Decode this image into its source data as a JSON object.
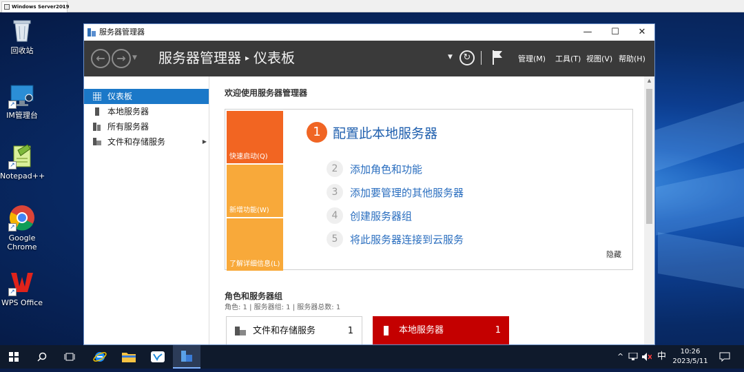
{
  "vm": {
    "tab_title": "Windows Server2019",
    "tab_close": "✕"
  },
  "desktop": {
    "icons": [
      {
        "label": "回收站"
      },
      {
        "label": "IM管理台"
      },
      {
        "label": "Notepad++"
      },
      {
        "label": "Google\nChrome"
      },
      {
        "label": "WPS Office"
      }
    ]
  },
  "window": {
    "title": "服务器管理器",
    "controls": {
      "minimize": "—",
      "maximize": "☐",
      "close": "✕"
    },
    "breadcrumb": {
      "root": "服务器管理器",
      "separator": "▸",
      "current": "仪表板"
    },
    "menu": {
      "manage": "管理(M)",
      "tools": "工具(T)",
      "view": "视图(V)",
      "help": "帮助(H)"
    },
    "sidebar": {
      "items": [
        {
          "label": "仪表板",
          "icon": "dashboard-icon"
        },
        {
          "label": "本地服务器",
          "icon": "server-icon"
        },
        {
          "label": "所有服务器",
          "icon": "servers-icon"
        },
        {
          "label": "文件和存储服务",
          "icon": "storage-icon"
        }
      ]
    },
    "welcome": {
      "title": "欢迎使用服务器管理器",
      "tiles": [
        {
          "label": "快速启动(Q)",
          "color": "#f26522"
        },
        {
          "label": "新增功能(W)",
          "color": "#f8a93a"
        },
        {
          "label": "了解详细信息(L)",
          "color": "#f8a93a"
        }
      ],
      "steps": [
        {
          "num": "1",
          "label": "配置此本地服务器"
        },
        {
          "num": "2",
          "label": "添加角色和功能"
        },
        {
          "num": "3",
          "label": "添加要管理的其他服务器"
        },
        {
          "num": "4",
          "label": "创建服务器组"
        },
        {
          "num": "5",
          "label": "将此服务器连接到云服务"
        }
      ],
      "hide": "隐藏"
    },
    "roles": {
      "title": "角色和服务器组",
      "subtitle": "角色: 1 | 服务器组: 1 | 服务器总数: 1",
      "cards": [
        {
          "label": "文件和存储服务",
          "count": "1",
          "status_color": "#3dbb3d"
        },
        {
          "label": "本地服务器",
          "count": "1",
          "status_color": "#c40000"
        }
      ]
    }
  },
  "taskbar": {
    "tray": {
      "chevron": "^",
      "ime": "中"
    },
    "clock": {
      "time": "10:26",
      "date": "2023/5/11"
    }
  },
  "colors": {
    "accent": "#1b78c8",
    "header_bg": "#3a3a3a",
    "quick_start": "#f26522",
    "link": "#2a6ebf"
  }
}
